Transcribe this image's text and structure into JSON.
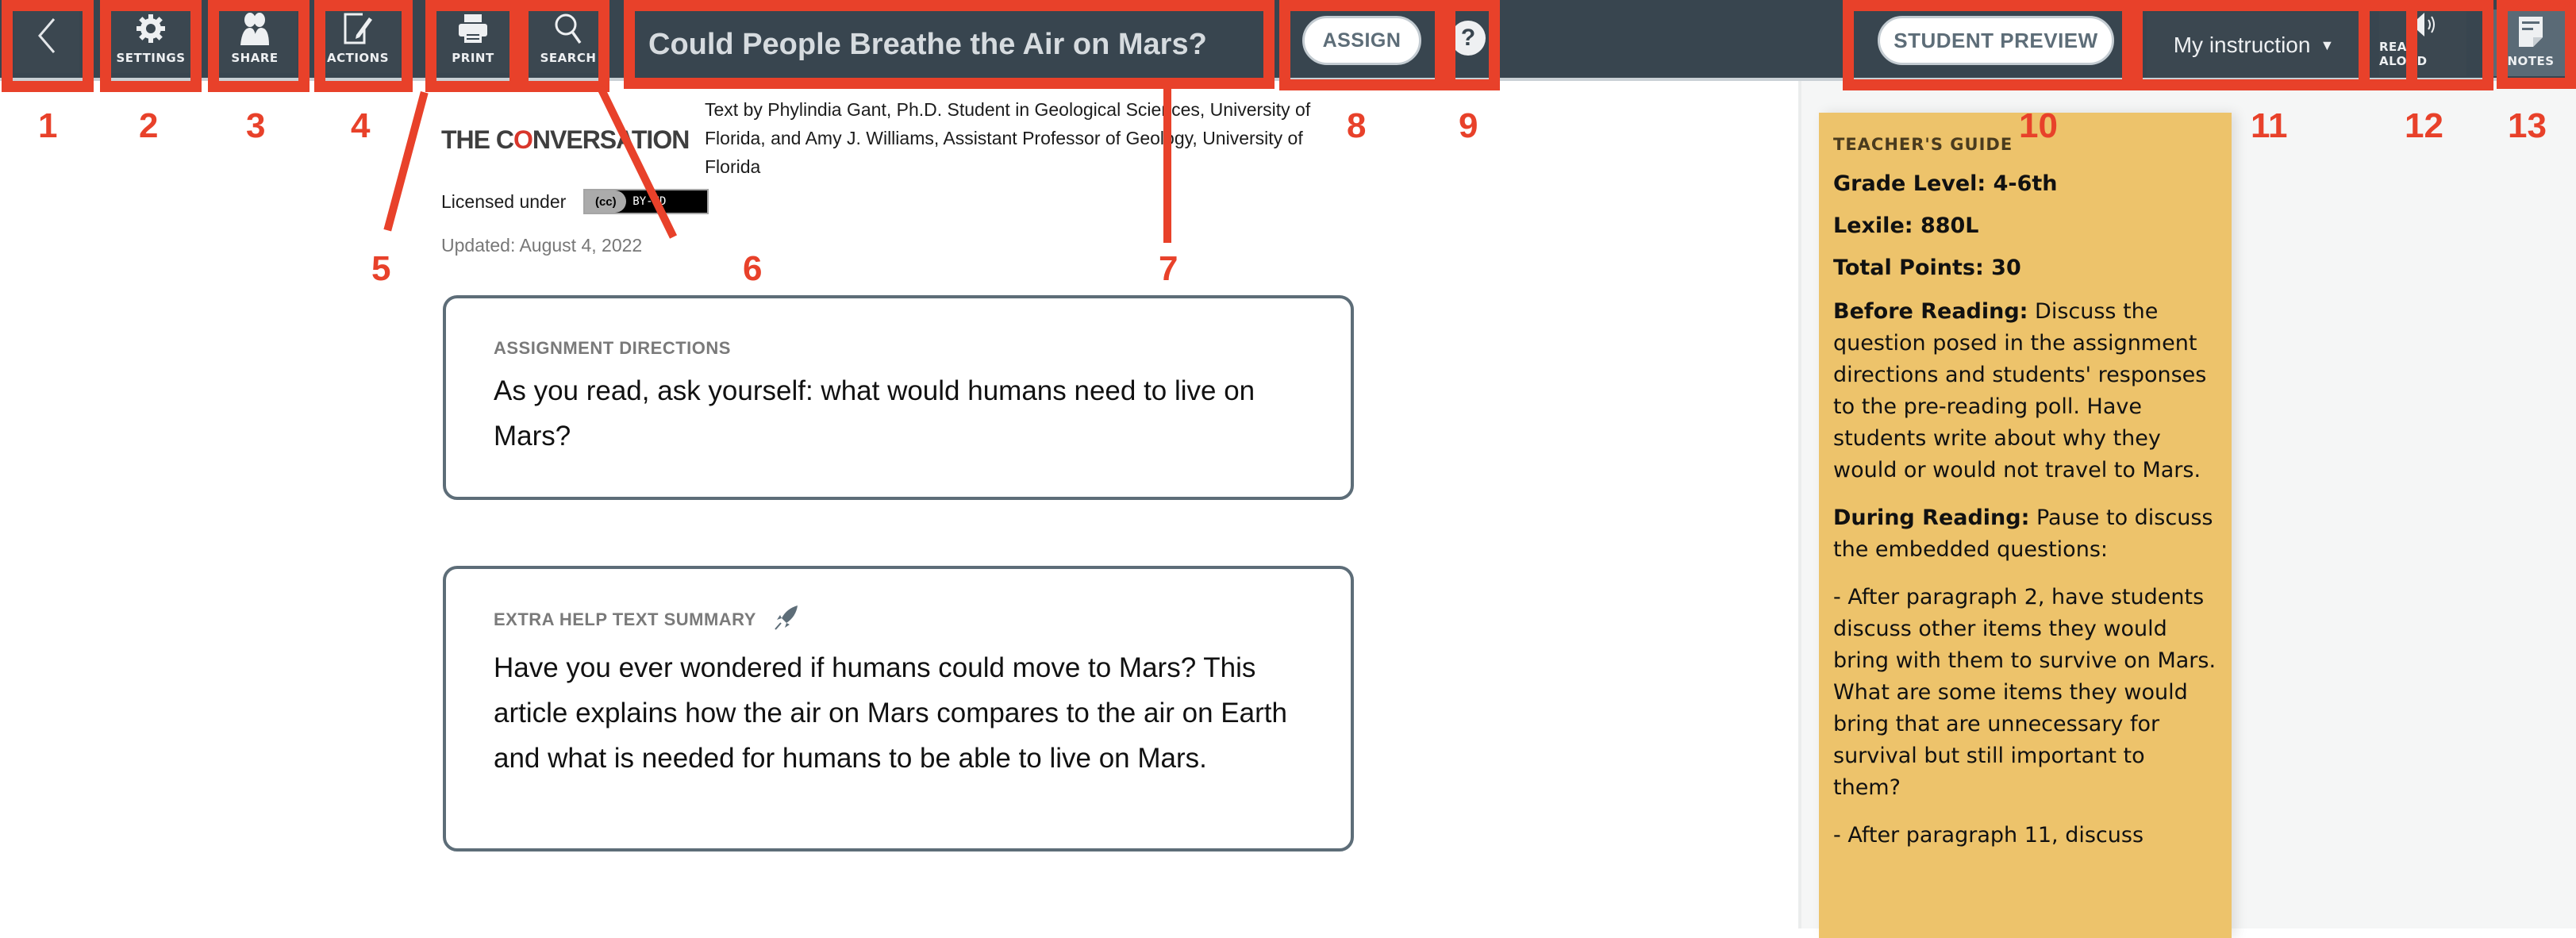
{
  "header": {
    "toolbar": [
      {
        "id": "back",
        "label": "",
        "icon": "chevron-left-icon"
      },
      {
        "id": "settings",
        "label": "SETTINGS",
        "icon": "gear-icon"
      },
      {
        "id": "share",
        "label": "SHARE",
        "icon": "people-icon"
      },
      {
        "id": "actions",
        "label": "ACTIONS",
        "icon": "edit-icon"
      },
      {
        "id": "print",
        "label": "PRINT",
        "icon": "printer-icon"
      },
      {
        "id": "search",
        "label": "SEARCH",
        "icon": "search-icon"
      }
    ],
    "title": "Could People Breathe the Air on Mars?",
    "assign_label": "ASSIGN",
    "help_icon": "question-circle-icon",
    "student_preview_label": "STUDENT PREVIEW",
    "instruction_select": "My instruction",
    "read_aloud_label": "READ ALOUD",
    "notes_label": "NOTES",
    "colors": {
      "header_bg": "#38454f",
      "guide_bg": "#edc36b",
      "annotation": "#e8412a",
      "card_border": "#5d6d78"
    }
  },
  "article": {
    "source_logo": {
      "pre": "THE C",
      "o": "O",
      "post": "NVERSATION"
    },
    "byline": "Text by Phylindia Gant, Ph.D. Student in Geological Sciences, University of Florida, and Amy J. Williams, Assistant Professor of Geology, University of Florida",
    "licensed_label": "Licensed under",
    "license_badge": {
      "cc": "(cc)",
      "terms": "BY-ND"
    },
    "updated": "Updated: August 4, 2022",
    "directions": {
      "kicker": "ASSIGNMENT DIRECTIONS",
      "body": "As you read, ask yourself: what would humans need to live on Mars?"
    },
    "summary": {
      "kicker": "EXTRA HELP TEXT SUMMARY",
      "icon": "rocket-icon",
      "body": "Have you ever wondered if humans could move to Mars? This article explains how the air on Mars compares to the air on Earth and what is needed for humans to be able to live on Mars."
    }
  },
  "teacher_guide": {
    "title": "TEACHER'S GUIDE",
    "grade_level": "Grade Level: 4-6th",
    "lexile": "Lexile: 880L",
    "total_points": "Total Points: 30",
    "before_label": "Before Reading:",
    "before_text": " Discuss the question posed in the assignment directions and students' responses to the pre-reading poll. Have students write about why they would or would not travel to Mars.",
    "during_label": "During Reading:",
    "during_text": " Pause to discuss the embedded questions:",
    "bullet1": "- After paragraph 2, have students discuss other items they would bring with them to survive on Mars. What are some items they would bring that are unnecessary for survival but still important to them?",
    "bullet2": "- After paragraph 11, discuss"
  },
  "annotations": [
    "1",
    "2",
    "3",
    "4",
    "5",
    "6",
    "7",
    "8",
    "9",
    "10",
    "11",
    "12",
    "13"
  ]
}
